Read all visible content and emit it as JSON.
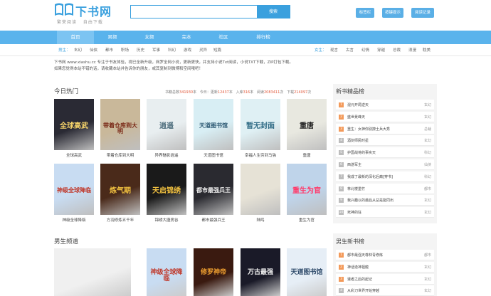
{
  "header": {
    "logo_text": "下书网",
    "slogan": "繁荣阅读 自由下载",
    "search_placeholder": "",
    "search_button": "搜索",
    "buttons": [
      "标签栏",
      "按键提示",
      "阅读记录"
    ]
  },
  "nav": [
    "首页",
    "男频",
    "女频",
    "完本",
    "社区",
    "排行榜"
  ],
  "subnav": {
    "male_label": "男生：",
    "male": [
      "玄幻",
      "仙侠",
      "都市",
      "职场",
      "历史",
      "军事",
      "科幻",
      "游戏",
      "灵异",
      "短篇"
    ],
    "female_label": "女生：",
    "female": [
      "现言",
      "古言",
      "幻情",
      "穿越",
      "总裁",
      "浪漫",
      "耽美"
    ]
  },
  "notice": {
    "line1": "下书网 www.xiashu.cc 专注于书友体验，视已全新升级，网罗全网小说，更新更快，并支持小说Txt阅读，小说TXT下载，ZIP打包下载。",
    "line2": "如果您觉得本站不错的话，请收藏本站并告诉你的朋友，或其复制到微博和空间哦吧！"
  },
  "hot": {
    "title": "今日热门",
    "stats": [
      {
        "label": "书籍总数",
        "value": "341930",
        "unit": "本"
      },
      {
        "label": "今日：更新",
        "value": "12437",
        "unit": "本"
      },
      {
        "label": "入库",
        "value": "316",
        "unit": "本"
      },
      {
        "label": "阅读",
        "value": "2083411",
        "unit": "次"
      },
      {
        "label": "下载",
        "value": "214097",
        "unit": "次"
      }
    ],
    "books": [
      {
        "name": "全球高武",
        "cover": "全球高武",
        "bg": "#2a2a34",
        "fg": "#f5d36a"
      },
      {
        "name": "带着仓库到大明",
        "cover": "带着仓库到大明",
        "bg": "#c9b89a",
        "fg": "#7a2a18"
      },
      {
        "name": "异界魅影逍遥",
        "cover": "逍遥",
        "bg": "#e8eef0",
        "fg": "#4a6a7a"
      },
      {
        "name": "天道图书馆",
        "cover": "天道图书馆",
        "bg": "#d8eef4",
        "fg": "#2e5a74"
      },
      {
        "name": "幸福人生穷到马強",
        "cover": "暂无封面",
        "bg": "#dff0f4",
        "fg": "#2e6a84"
      },
      {
        "name": "重唐",
        "cover": "重唐",
        "bg": "#e8e8e0",
        "fg": "#222"
      },
      {
        "name": "神级全球降临",
        "cover": "神级全球降临",
        "bg": "#c8dcf2",
        "fg": "#c0392b"
      },
      {
        "name": "方羽修炼五千年",
        "cover": "炼气期",
        "bg": "#4a2a1a",
        "fg": "#f0c040"
      },
      {
        "name": "锦绣大唐房谷",
        "cover": "天启锦绣",
        "bg": "#1a1a1a",
        "fg": "#f0c040"
      },
      {
        "name": "都市最强兵王",
        "cover": "都市最强兵王",
        "bg": "#2a2a30",
        "fg": "#f0f0f0"
      },
      {
        "name": "陆鸣",
        "cover": "",
        "bg": "#e6e2d6",
        "fg": "#2e2e2e"
      },
      {
        "name": "重生为官",
        "cover": "重生为官",
        "bg": "#bfd4ea",
        "fg": "#ff3a6a"
      }
    ]
  },
  "male": {
    "title": "男生频道",
    "covers": [
      {
        "cover": "",
        "bg": "#f0f0f0",
        "fg": "#888"
      },
      {
        "cover": "神级全球降临",
        "bg": "#c8dcf2",
        "fg": "#c0392b"
      },
      {
        "cover": "修罗神帝",
        "bg": "#3a1a10",
        "fg": "#f0a030"
      },
      {
        "cover": "万古最强",
        "bg": "#1a1a28",
        "fg": "#f0f0f0"
      },
      {
        "cover": "天道图书馆",
        "bg": "#e6eef6",
        "fg": "#2e4a6a"
      }
    ]
  },
  "rank_new": {
    "title": "新书精品榜",
    "items": [
      {
        "name": "混元开局逆天",
        "cat": "玄幻"
      },
      {
        "name": "盛世景峰天",
        "cat": "玄幻"
      },
      {
        "name": "重生：女神你别撩士兵大秀",
        "cat": "总裁"
      },
      {
        "name": "酒剑师民时星",
        "cat": "玄幻"
      },
      {
        "name": "护国战将的事实天",
        "cat": "科幻"
      },
      {
        "name": "西游军主",
        "cat": "仙侠"
      },
      {
        "name": "我成了最新的深化后裔[穿书]",
        "cat": "科幻"
      },
      {
        "name": "林北楼墨竹",
        "cat": "都市"
      },
      {
        "name": "我兴趣以的最后从总是能同出",
        "cat": "玄幻"
      },
      {
        "name": "死神的狂",
        "cat": "玄幻"
      }
    ]
  },
  "rank_male": {
    "title": "男生新书榜",
    "items": [
      {
        "name": "都市最强天尊林青修炼",
        "cat": "都市"
      },
      {
        "name": "神话逸神祖龍",
        "cat": "玄幻"
      },
      {
        "name": "遣者之后的起记",
        "cat": "玄幻"
      },
      {
        "name": "从彩刀世界开始穿越",
        "cat": "玄幻"
      }
    ]
  }
}
